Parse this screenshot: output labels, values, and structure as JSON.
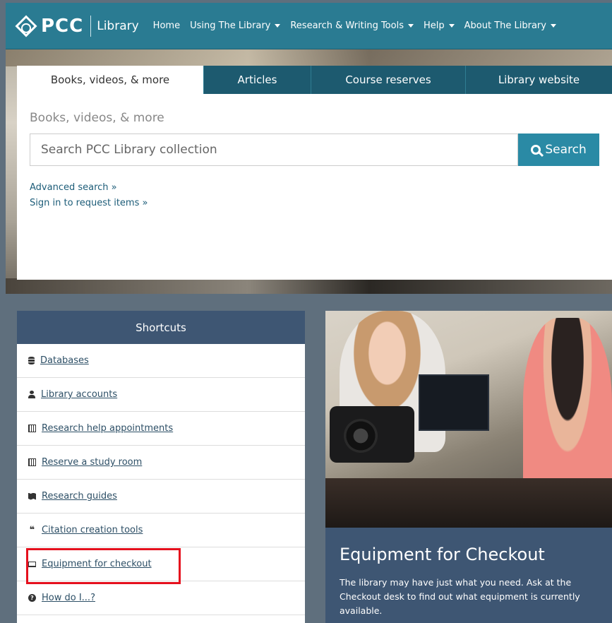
{
  "nav": {
    "logo_text": "PCC",
    "logo_sub": "Library",
    "links": [
      {
        "label": "Home",
        "dropdown": false
      },
      {
        "label": "Using The Library",
        "dropdown": true
      },
      {
        "label": "Research & Writing Tools",
        "dropdown": true
      },
      {
        "label": "Help",
        "dropdown": true
      },
      {
        "label": "About The Library",
        "dropdown": true
      }
    ]
  },
  "search": {
    "tabs": [
      "Books, videos, & more",
      "Articles",
      "Course reserves",
      "Library website"
    ],
    "heading": "Books, videos, & more",
    "placeholder": "Search PCC Library collection",
    "button_label": "Search",
    "advanced": "Advanced search »",
    "signin": "Sign in to request items »"
  },
  "shortcuts": {
    "title": "Shortcuts",
    "items": [
      {
        "label": "Databases",
        "icon": "database-icon"
      },
      {
        "label": "Library accounts",
        "icon": "user-icon"
      },
      {
        "label": "Research help appointments",
        "icon": "calendar-icon"
      },
      {
        "label": "Reserve a study room",
        "icon": "calendar-icon"
      },
      {
        "label": "Research guides",
        "icon": "map-icon"
      },
      {
        "label": "Citation creation tools",
        "icon": "quote-icon"
      },
      {
        "label": "Equipment for checkout",
        "icon": "laptop-icon"
      },
      {
        "label": "How do I...?",
        "icon": "question-circle-icon"
      }
    ]
  },
  "feature": {
    "title": "Equipment for Checkout",
    "text": "The library may have just what you need. Ask at the Checkout desk to find out what equipment is currently available."
  },
  "colors": {
    "nav_bg": "#2a7b92",
    "tab_dark": "#1d5a6f",
    "search_button": "#2a8aa5",
    "shortcuts_header": "#3e5673",
    "highlight": "#e5101d"
  }
}
